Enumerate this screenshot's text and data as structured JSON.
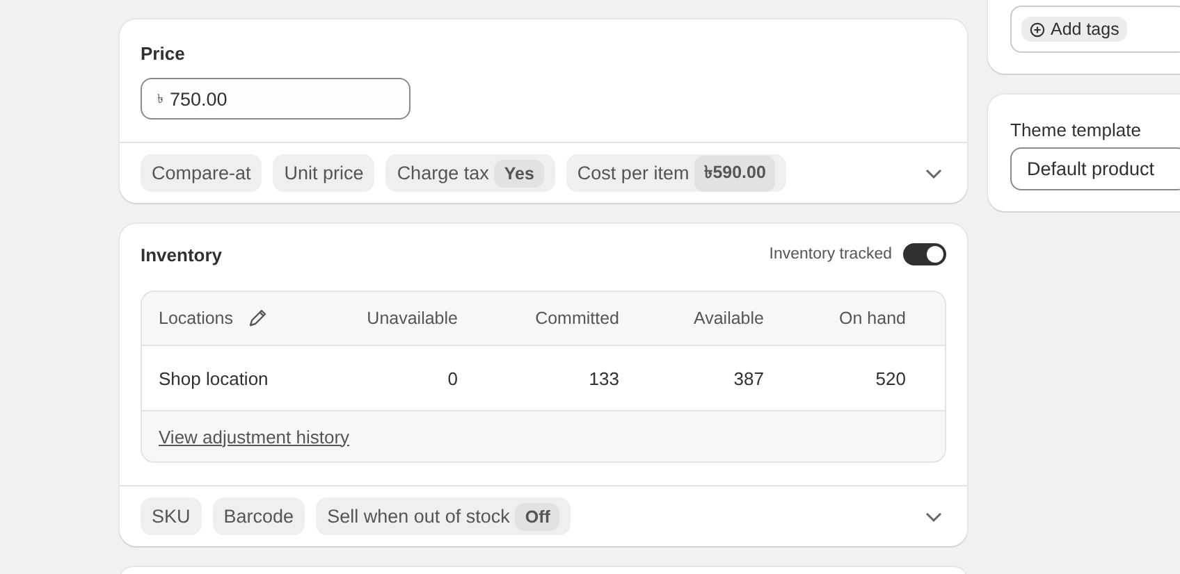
{
  "price_card": {
    "title": "Price",
    "price_field": {
      "currency": "৳",
      "value": "750.00"
    },
    "chips": [
      {
        "label": "Compare-at"
      },
      {
        "label": "Unit price"
      },
      {
        "label": "Charge tax",
        "value": "Yes"
      },
      {
        "label": "Cost per item",
        "value": "৳590.00"
      }
    ]
  },
  "inventory_card": {
    "title": "Inventory",
    "tracked": {
      "label": "Inventory tracked",
      "on": true
    },
    "table": {
      "columns": [
        "Locations",
        "Unavailable",
        "Committed",
        "Available",
        "On hand"
      ],
      "rows": [
        [
          "Shop location",
          "0",
          "133",
          "387",
          "520"
        ]
      ],
      "footer_link": "View adjustment history"
    },
    "chips": [
      {
        "label": "SKU"
      },
      {
        "label": "Barcode"
      },
      {
        "label": "Sell when out of stock",
        "value": "Off"
      }
    ]
  },
  "tags_card": {
    "button": "Add tags"
  },
  "theme_card": {
    "title": "Theme template",
    "select": "Default product"
  }
}
